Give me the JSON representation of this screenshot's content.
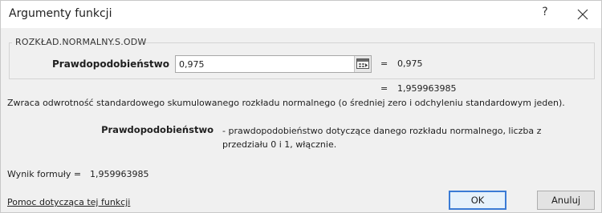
{
  "window": {
    "title": "Argumenty funkcji",
    "help_glyph": "?"
  },
  "function_group": {
    "name": "ROZKŁAD.NORMALNY.S.ODW",
    "argument": {
      "label": "Prawdopodobieństwo",
      "value": "0,975",
      "evaluated": "0,975"
    }
  },
  "function_result_line": "1,959963985",
  "equals_sign": "=",
  "description": "Zwraca odwrotność standardowego skumulowanego rozkładu normalnego (o średniej zero i odchyleniu standardowym jeden).",
  "parameter_help": {
    "name": "Prawdopodobieństwo",
    "text": "- prawdopodobieństwo dotyczące danego rozkładu normalnego, liczba z przedziału 0 i 1, włącznie."
  },
  "formula_result": {
    "label": "Wynik formuły =",
    "value": "1,959963985"
  },
  "footer": {
    "help_link": "Pomoc dotycząca tej funkcji",
    "ok_label": "OK",
    "cancel_label": "Anuluj"
  },
  "icons": {
    "collapse": "range-select-icon",
    "close": "close-icon"
  }
}
